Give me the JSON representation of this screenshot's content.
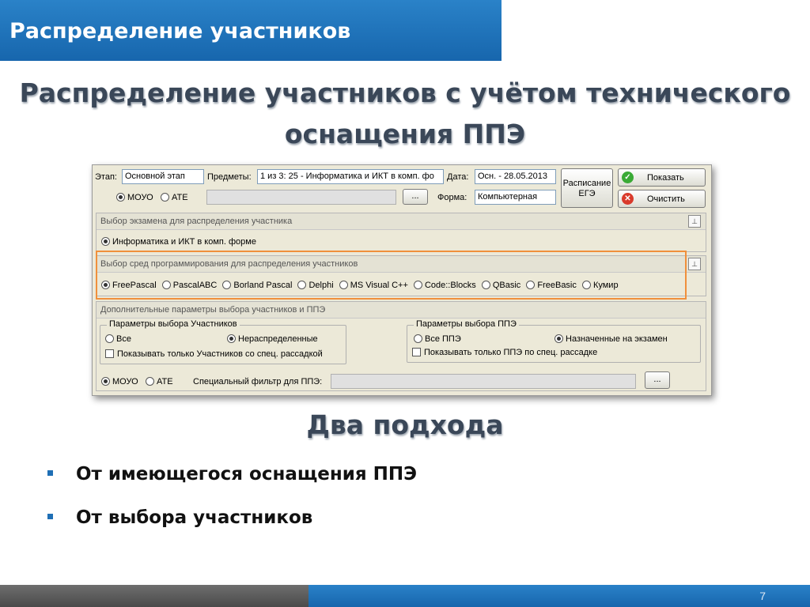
{
  "header": {
    "title": "Распределение участников"
  },
  "slide_title": {
    "line1": "Распределение участников с учётом технического",
    "line2": "оснащения ППЭ"
  },
  "app": {
    "etap_label": "Этап:",
    "etap_value": "Основной этап",
    "predmety_label": "Предметы:",
    "predmety_value": "1 из 3: 25 - Информатика и ИКТ в комп. фо",
    "data_label": "Дата:",
    "data_value": "Осн. - 28.05.2013",
    "schedule_button": "Расписание ЕГЭ",
    "show_button": "Показать",
    "clear_button": "Очистить",
    "moyo_label": "МОУО",
    "ate_label": "АТЕ",
    "browse_label": "...",
    "forma_label": "Форма:",
    "forma_value": "Компьютерная",
    "exam_group": {
      "title": "Выбор экзамена для распределения участника",
      "option": "Информатика и ИКТ в комп. форме"
    },
    "env_group": {
      "title": "Выбор сред программирования для распределения участников",
      "options": [
        "FreePascal",
        "PascalABC",
        "Borland Pascal",
        "Delphi",
        "MS Visual C++",
        "Code::Blocks",
        "QBasic",
        "FreeBasic",
        "Кумир"
      ]
    },
    "extra_group": {
      "title": "Дополнительные параметры выбора участников и ППЭ",
      "participants_legend": "Параметры выбора Участников",
      "all_label": "Все",
      "unassigned_label": "Нераспределенные",
      "special_participants": "Показывать только Участников со спец. рассадкой",
      "ppe_legend": "Параметры выбора ППЭ",
      "all_ppe_label": "Все ППЭ",
      "assigned_label": "Назначенные на экзамен",
      "special_ppe": "Показывать только ППЭ по спец. рассадке",
      "moyo_label": "МОУО",
      "ate_label": "АТЕ",
      "filter_label": "Специальный фильтр для ППЭ:",
      "browse_label": "..."
    }
  },
  "subtitle": "Два подхода",
  "bullets": [
    "От имеющегося оснащения ППЭ",
    "От выбора участников"
  ],
  "page_number": "7",
  "colors": {
    "accent": "#1f6fb5",
    "highlight": "#f0903c"
  }
}
